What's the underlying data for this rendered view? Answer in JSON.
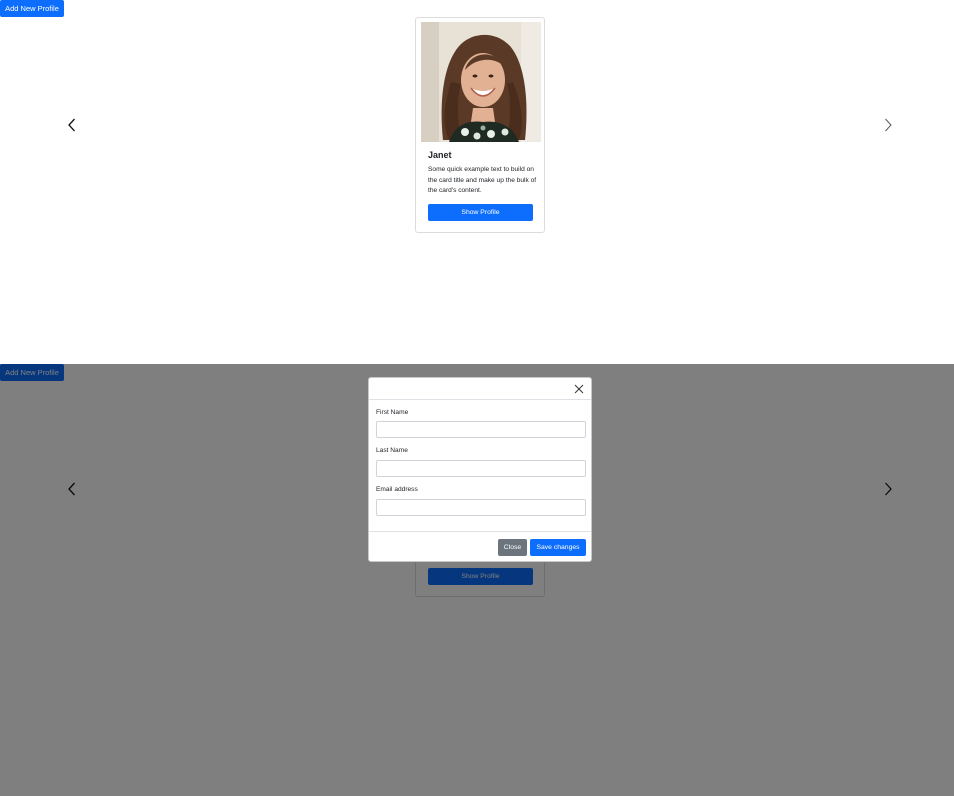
{
  "toolbar": {
    "add_profile_label": "Add New Profile"
  },
  "carousel": {
    "prev_icon": "chevron-left-icon",
    "next_icon": "chevron-right-icon"
  },
  "profile_card": {
    "name": "Janet",
    "description": "Some quick example text to build on the card title and make up the bulk of the card's content.",
    "show_profile_label": "Show Profile",
    "photo_icon": "person-photo"
  },
  "modal": {
    "close_icon": "close-icon",
    "fields": [
      {
        "label": "First Name",
        "value": "",
        "placeholder": ""
      },
      {
        "label": "Last Name",
        "value": "",
        "placeholder": ""
      },
      {
        "label": "Email address",
        "value": "",
        "placeholder": ""
      }
    ],
    "close_label": "Close",
    "save_label": "Save changes"
  },
  "colors": {
    "primary": "#0d6efd",
    "secondary": "#6c757d",
    "backdrop": "rgba(0,0,0,0.5)"
  }
}
